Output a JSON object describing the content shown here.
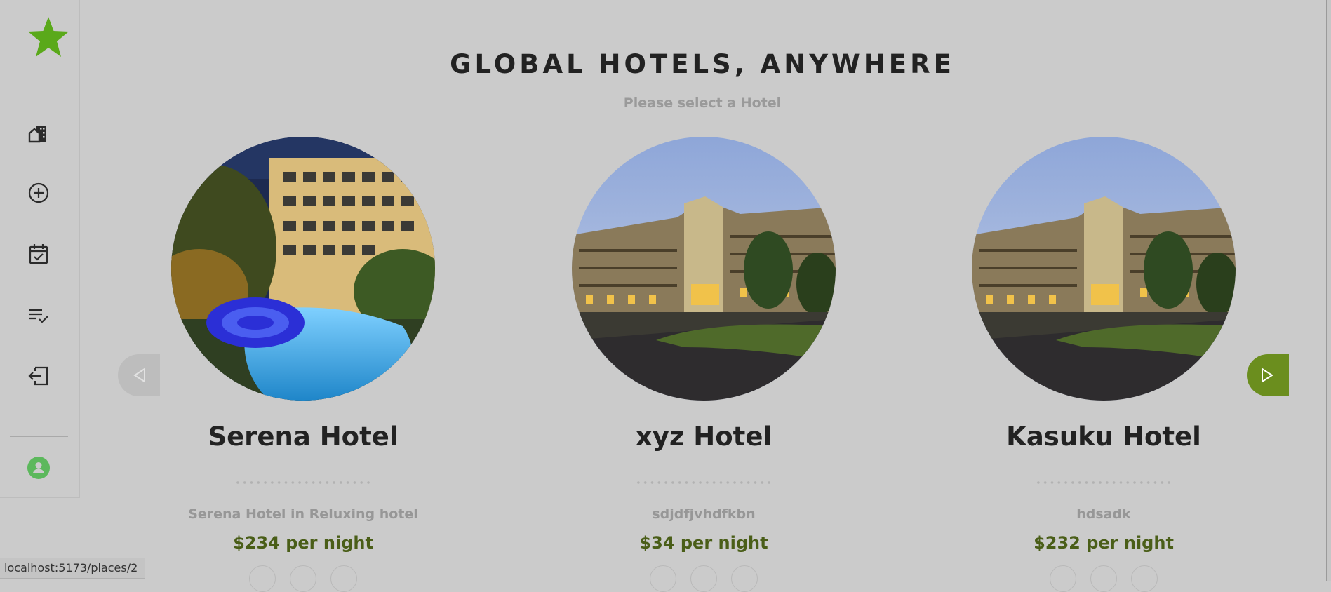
{
  "header": {
    "title": "GLOBAL HOTELS, ANYWHERE",
    "subtitle": "Please select a Hotel"
  },
  "sidebar": {
    "items": [
      {
        "icon": "building-icon"
      },
      {
        "icon": "add-circle-icon"
      },
      {
        "icon": "calendar-check-icon"
      },
      {
        "icon": "list-check-icon"
      },
      {
        "icon": "logout-icon"
      }
    ],
    "avatar_icon": "user-icon"
  },
  "hotels": [
    {
      "name": "Serena Hotel",
      "description": "Serena Hotel in Reluxing hotel",
      "price": "$234 per night"
    },
    {
      "name": "xyz Hotel",
      "description": "sdjdfjvhdfkbn",
      "price": "$34 per night"
    },
    {
      "name": "Kasuku Hotel",
      "description": "hdsadk",
      "price": "$232 per night"
    }
  ],
  "status_bar": {
    "url": "localhost:5173/places/2"
  },
  "colors": {
    "accent": "#6b8e1e",
    "logo": "#5aa91a",
    "price": "#4a5e18",
    "avatar": "#5cb85c"
  }
}
